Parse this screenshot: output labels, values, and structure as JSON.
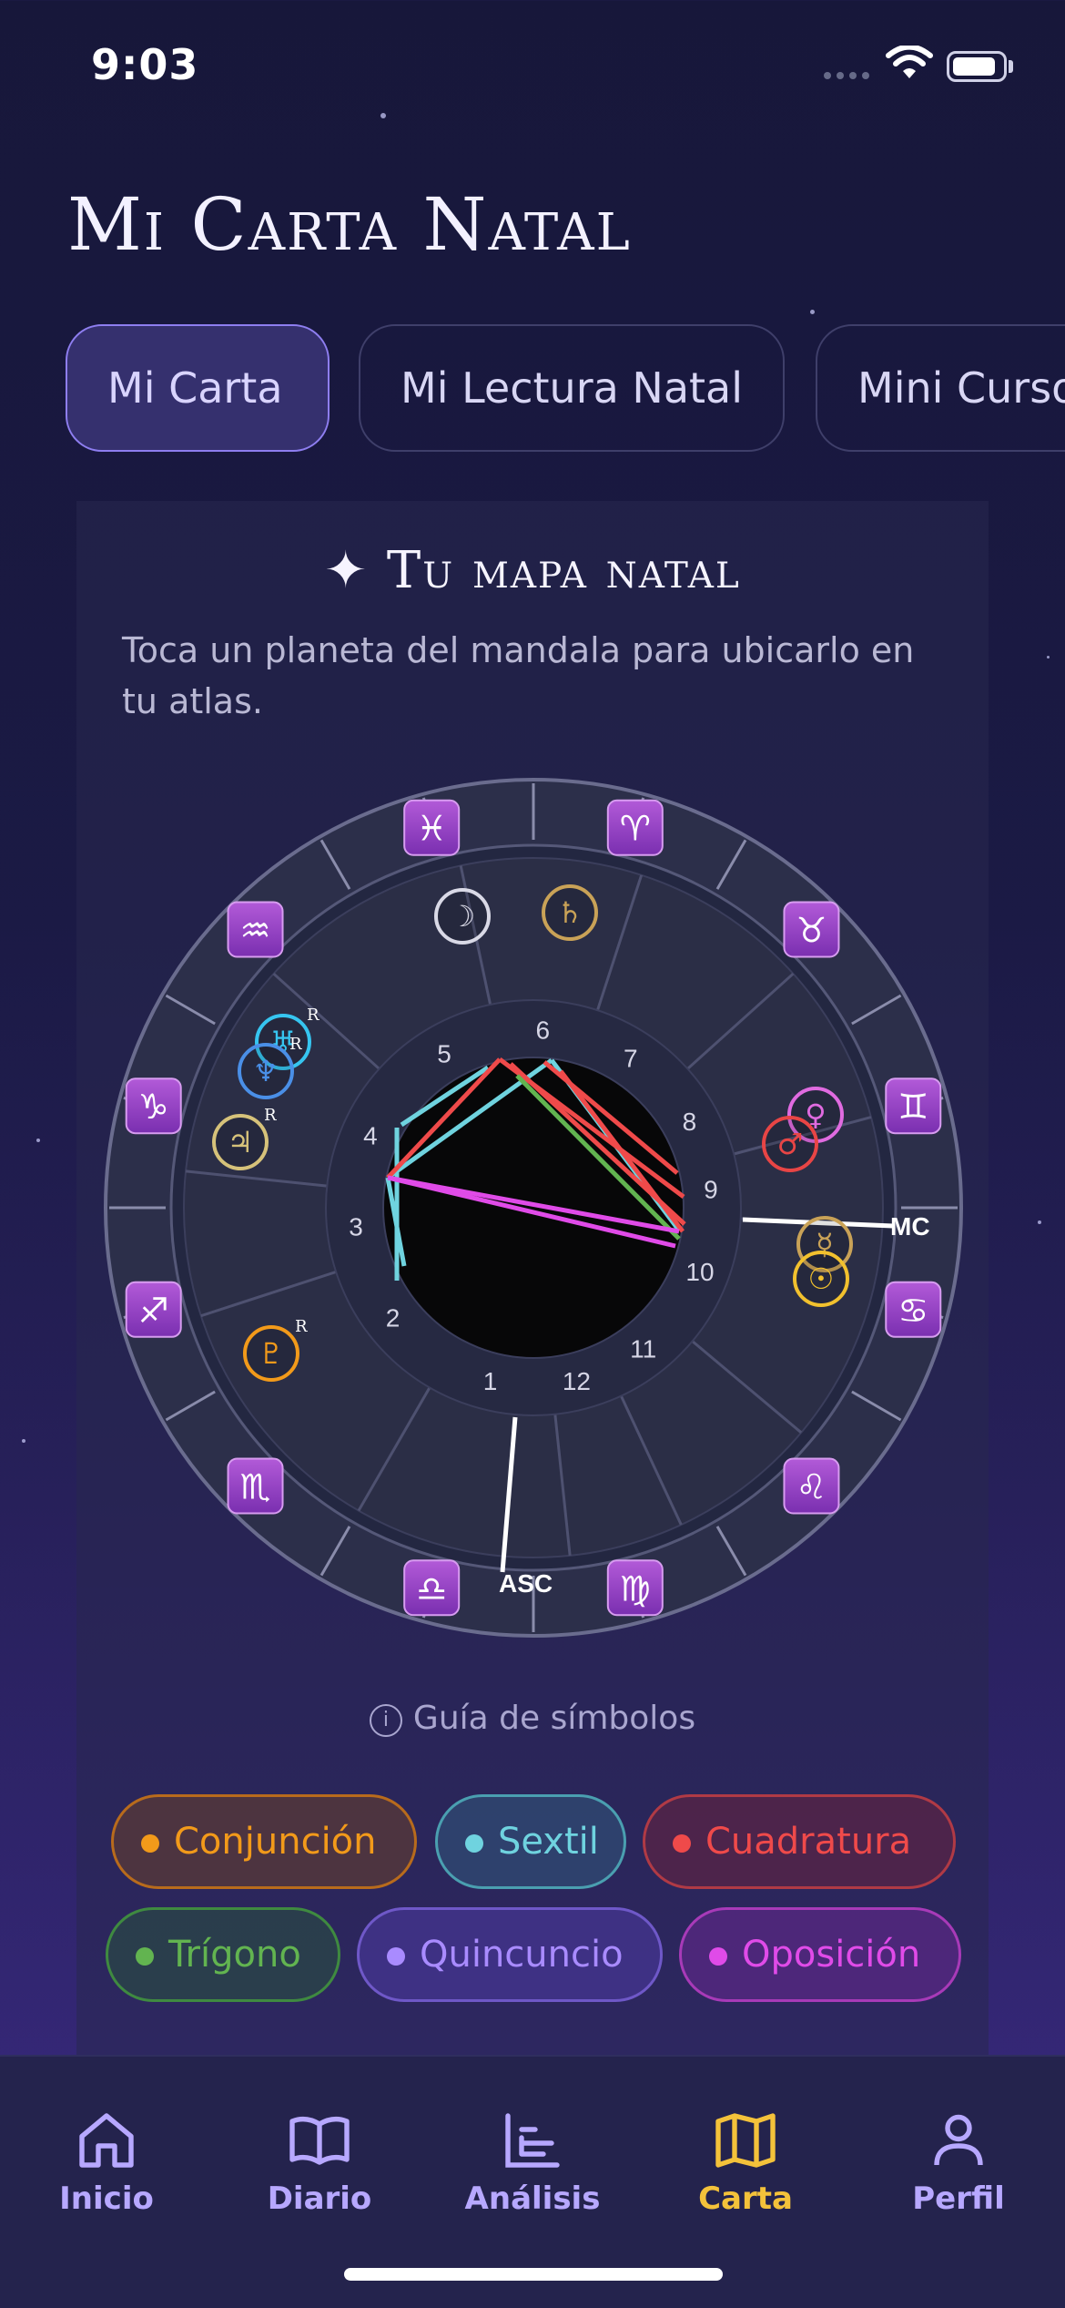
{
  "status_bar": {
    "time": "9:03"
  },
  "page_title": "Mi Carta Natal",
  "tabs": [
    {
      "label": "Mi Carta",
      "active": true
    },
    {
      "label": "Mi Lectura Natal",
      "active": false
    },
    {
      "label": "Mini Curso",
      "active": false
    }
  ],
  "card": {
    "title": "✦ Tu mapa natal",
    "subtitle": "Toca un planeta del mandala para ubicarlo en tu atlas."
  },
  "chart": {
    "signs": [
      {
        "name": "aries",
        "glyph": "♈"
      },
      {
        "name": "taurus",
        "glyph": "♉"
      },
      {
        "name": "gemini",
        "glyph": "♊"
      },
      {
        "name": "cancer",
        "glyph": "♋"
      },
      {
        "name": "leo",
        "glyph": "♌"
      },
      {
        "name": "virgo",
        "glyph": "♍"
      },
      {
        "name": "libra",
        "glyph": "♎"
      },
      {
        "name": "scorpio",
        "glyph": "♏"
      },
      {
        "name": "sagittarius",
        "glyph": "♐"
      },
      {
        "name": "capricorn",
        "glyph": "♑"
      },
      {
        "name": "aquarius",
        "glyph": "♒"
      },
      {
        "name": "pisces",
        "glyph": "♓"
      }
    ],
    "houses": [
      "1",
      "2",
      "3",
      "4",
      "5",
      "6",
      "7",
      "8",
      "9",
      "10",
      "11",
      "12"
    ],
    "angles": {
      "asc": "ASC",
      "mc": "MC"
    },
    "planets": [
      {
        "name": "moon",
        "glyph": "☽",
        "color": "#d9d9e6",
        "retro": ""
      },
      {
        "name": "saturn",
        "glyph": "♄",
        "color": "#c9a257",
        "retro": ""
      },
      {
        "name": "uranus",
        "glyph": "♅",
        "color": "#36c5f0",
        "retro": "R"
      },
      {
        "name": "neptune",
        "glyph": "♆",
        "color": "#4a8fe7",
        "retro": "R"
      },
      {
        "name": "jupiter",
        "glyph": "♃",
        "color": "#d6c27a",
        "retro": "R"
      },
      {
        "name": "pluto",
        "glyph": "♇",
        "color": "#f29a1a",
        "retro": "R"
      },
      {
        "name": "venus",
        "glyph": "♀",
        "color": "#e06be0",
        "retro": ""
      },
      {
        "name": "mars",
        "glyph": "♂",
        "color": "#e84545",
        "retro": ""
      },
      {
        "name": "mercury",
        "glyph": "☿",
        "color": "#c9a257",
        "retro": ""
      },
      {
        "name": "sun",
        "glyph": "☉",
        "color": "#f2c12e",
        "retro": ""
      }
    ]
  },
  "guide_label": "Guía de símbolos",
  "aspects": [
    {
      "label": "Conjunción",
      "color": "#f29a1a"
    },
    {
      "label": "Sextil",
      "color": "#6fd3df"
    },
    {
      "label": "Cuadratura",
      "color": "#ef4a4a"
    },
    {
      "label": "Trígono",
      "color": "#62b450"
    },
    {
      "label": "Quincuncio",
      "color": "#a98bff"
    },
    {
      "label": "Oposición",
      "color": "#e04be8"
    }
  ],
  "nav": [
    {
      "label": "Inicio",
      "icon": "home-icon",
      "active": false
    },
    {
      "label": "Diario",
      "icon": "book-icon",
      "active": false
    },
    {
      "label": "Análisis",
      "icon": "chart-icon",
      "active": false
    },
    {
      "label": "Carta",
      "icon": "map-icon",
      "active": true
    },
    {
      "label": "Perfil",
      "icon": "user-icon",
      "active": false
    }
  ]
}
